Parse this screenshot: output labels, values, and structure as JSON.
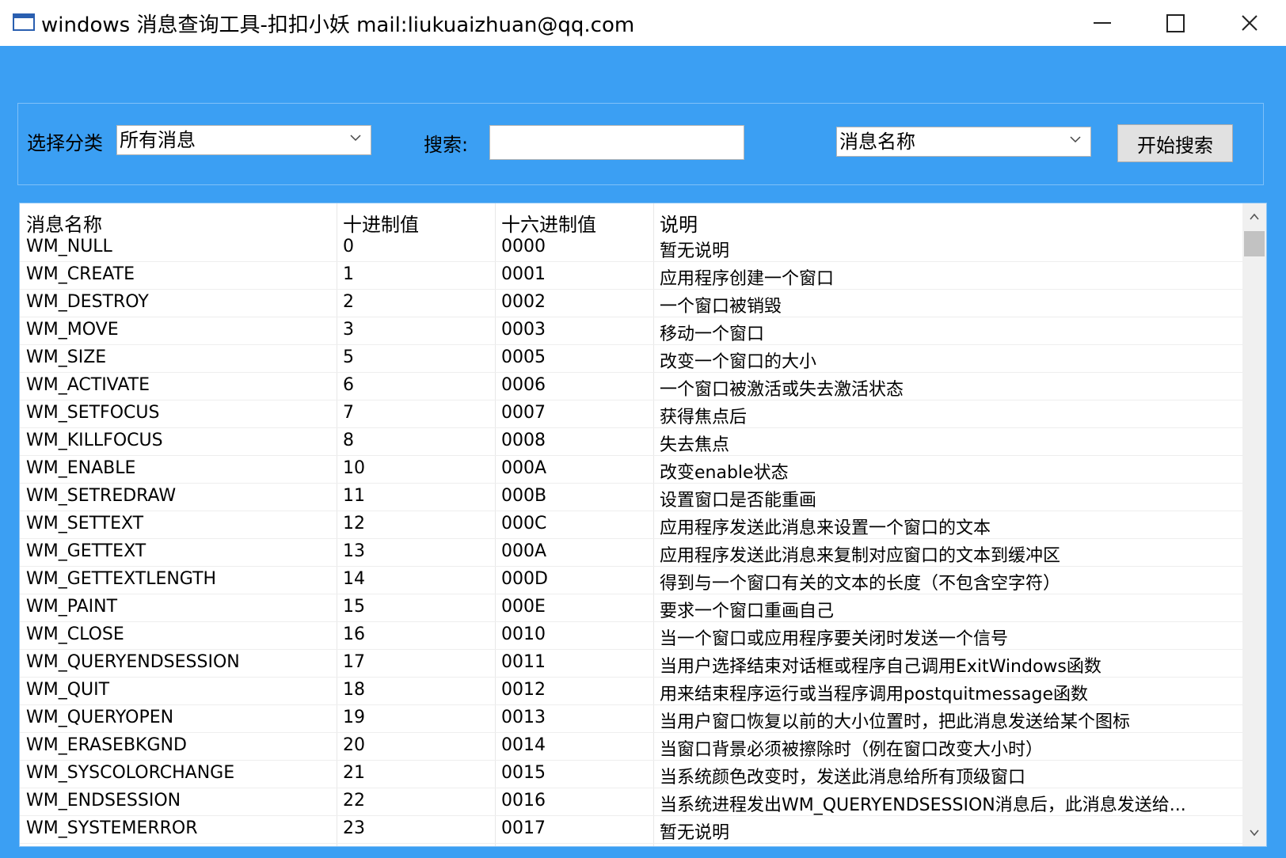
{
  "window": {
    "title": "windows 消息查询工具-扣扣小妖 mail:liukuaizhuan@qq.com"
  },
  "filter": {
    "category_label": "选择分类",
    "category_value": "所有消息",
    "search_label": "搜索:",
    "search_value": "",
    "field_value": "消息名称",
    "search_button": "开始搜索"
  },
  "table": {
    "columns": [
      "消息名称",
      "十进制值",
      "十六进制值",
      "说明"
    ],
    "rows": [
      [
        "WM_NULL",
        "0",
        "0000",
        "暂无说明"
      ],
      [
        "WM_CREATE",
        "1",
        "0001",
        "应用程序创建一个窗口"
      ],
      [
        "WM_DESTROY",
        "2",
        "0002",
        "一个窗口被销毁"
      ],
      [
        "WM_MOVE",
        "3",
        "0003",
        "移动一个窗口"
      ],
      [
        "WM_SIZE",
        "5",
        "0005",
        "改变一个窗口的大小"
      ],
      [
        "WM_ACTIVATE",
        "6",
        "0006",
        "一个窗口被激活或失去激活状态"
      ],
      [
        "WM_SETFOCUS",
        "7",
        "0007",
        "获得焦点后"
      ],
      [
        "WM_KILLFOCUS",
        "8",
        "0008",
        "失去焦点"
      ],
      [
        "WM_ENABLE",
        "10",
        "000A",
        "改变enable状态"
      ],
      [
        "WM_SETREDRAW",
        "11",
        "000B",
        "设置窗口是否能重画"
      ],
      [
        "WM_SETTEXT",
        "12",
        "000C",
        "应用程序发送此消息来设置一个窗口的文本"
      ],
      [
        "WM_GETTEXT",
        "13",
        "000A",
        "应用程序发送此消息来复制对应窗口的文本到缓冲区"
      ],
      [
        "WM_GETTEXTLENGTH",
        "14",
        "000D",
        "得到与一个窗口有关的文本的长度（不包含空字符）"
      ],
      [
        "WM_PAINT",
        "15",
        "000E",
        "要求一个窗口重画自己"
      ],
      [
        "WM_CLOSE",
        "16",
        "0010",
        "当一个窗口或应用程序要关闭时发送一个信号"
      ],
      [
        "WM_QUERYENDSESSION",
        "17",
        "0011",
        "当用户选择结束对话框或程序自己调用ExitWindows函数"
      ],
      [
        "WM_QUIT",
        "18",
        "0012",
        "用来结束程序运行或当程序调用postquitmessage函数"
      ],
      [
        "WM_QUERYOPEN",
        "19",
        "0013",
        "当用户窗口恢复以前的大小位置时，把此消息发送给某个图标"
      ],
      [
        "WM_ERASEBKGND",
        "20",
        "0014",
        "当窗口背景必须被擦除时（例在窗口改变大小时）"
      ],
      [
        "WM_SYSCOLORCHANGE",
        "21",
        "0015",
        "当系统颜色改变时，发送此消息给所有顶级窗口"
      ],
      [
        "WM_ENDSESSION",
        "22",
        "0016",
        "当系统进程发出WM_QUERYENDSESSION消息后，此消息发送给..."
      ],
      [
        "WM_SYSTEMERROR",
        "23",
        "0017",
        "暂无说明"
      ]
    ]
  },
  "icons": {
    "app": "window-icon",
    "minimize": "minimize-icon",
    "maximize": "maximize-icon",
    "close": "close-icon",
    "dropdown": "chevron-down-icon",
    "scroll_up": "chevron-up-icon",
    "scroll_down": "chevron-down-icon"
  },
  "colors": {
    "background": "#3b9ff3",
    "titlebar": "#ffffff",
    "button": "#e1e1e1"
  }
}
